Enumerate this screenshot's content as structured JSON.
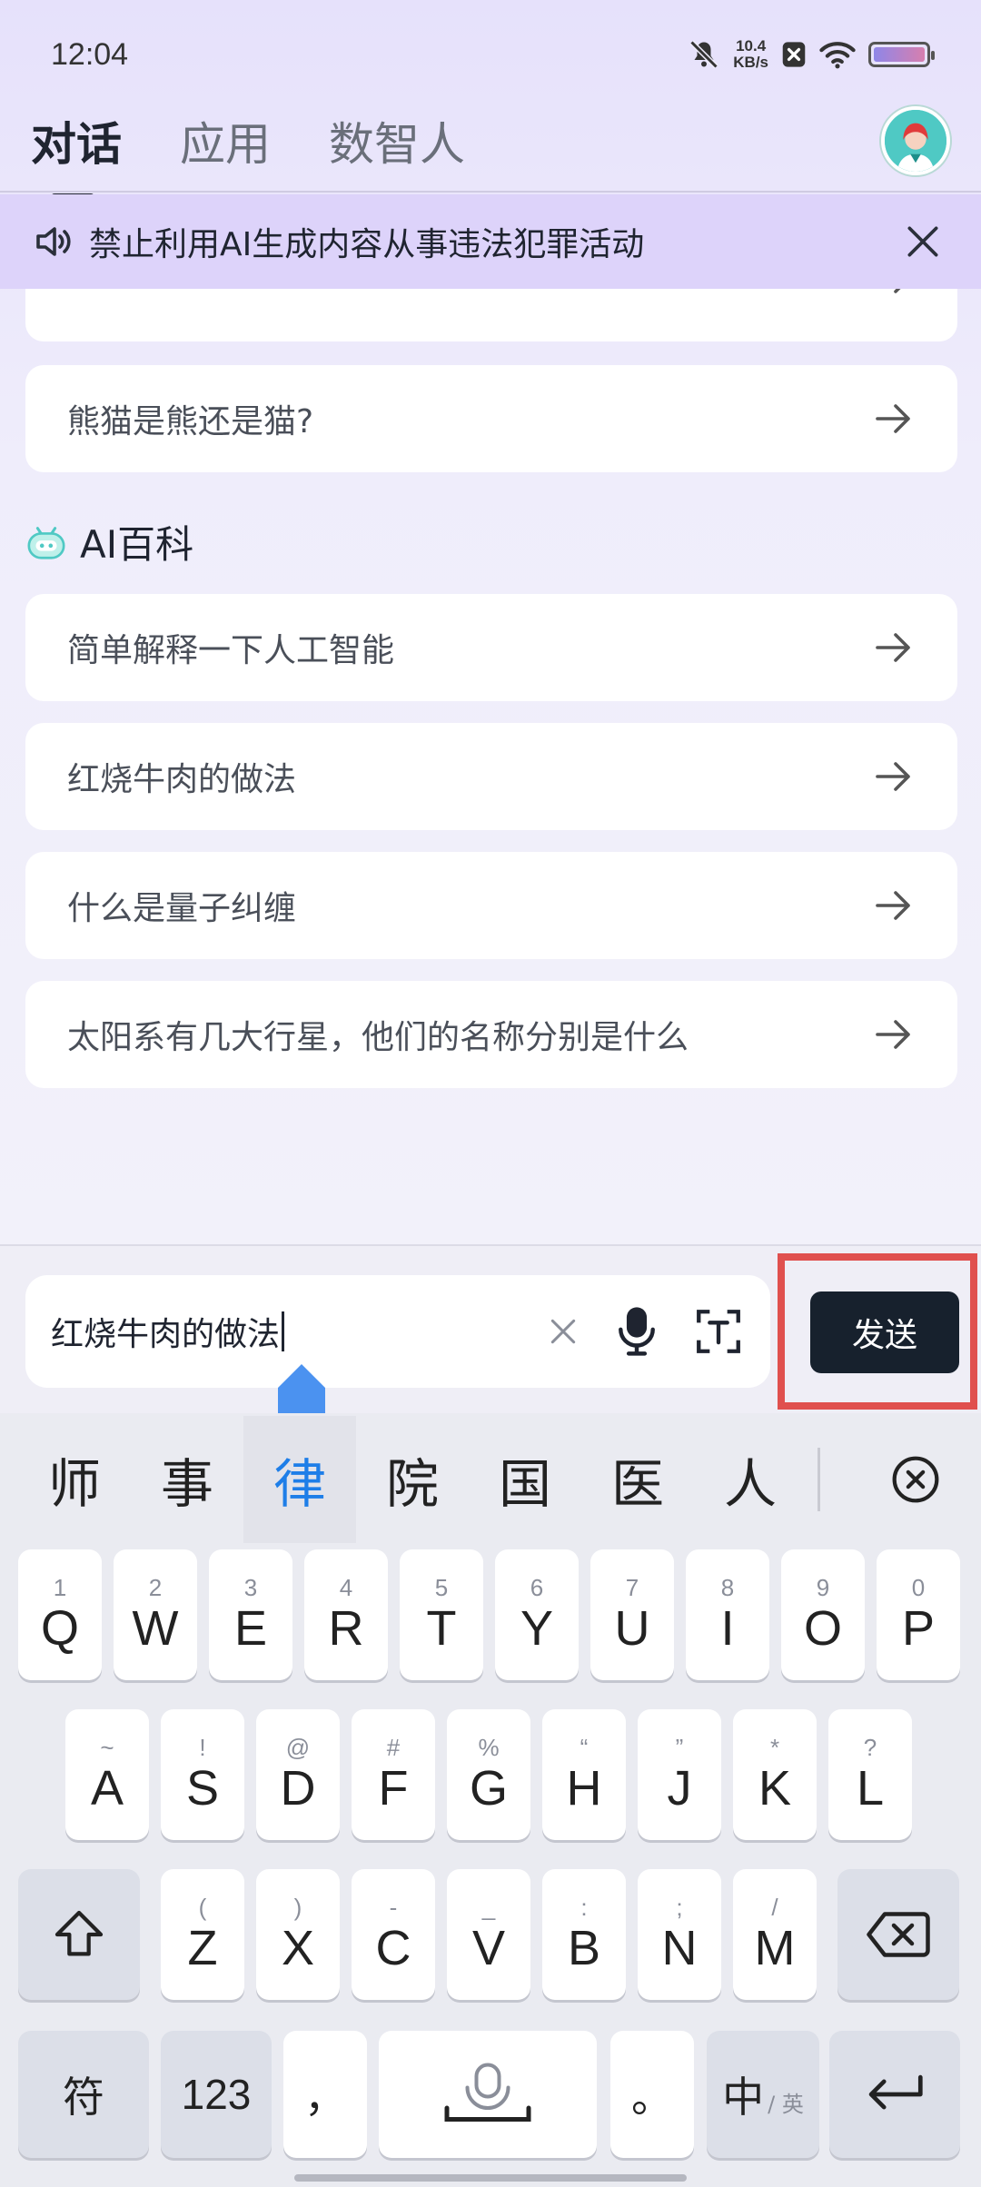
{
  "status_bar": {
    "time": "12:04",
    "net_speed_value": "10.4",
    "net_speed_unit": "KB/s",
    "icons": [
      "mute-bell-icon",
      "no-sim-icon",
      "wifi-icon",
      "battery-icon"
    ]
  },
  "header": {
    "tabs": [
      {
        "label": "对话",
        "active": true
      },
      {
        "label": "应用",
        "active": false
      },
      {
        "label": "数智人",
        "active": false
      }
    ]
  },
  "notice": {
    "text": "禁止利用AI生成内容从事违法犯罪活动"
  },
  "suggestions_top": [
    {
      "label": "熊猫是熊还是猫?"
    }
  ],
  "section": {
    "title": "AI百科",
    "items": [
      {
        "label": "简单解释一下人工智能"
      },
      {
        "label": "红烧牛肉的做法"
      },
      {
        "label": "什么是量子纠缠"
      },
      {
        "label": "太阳系有几大行星，他们的名称分别是什么"
      }
    ]
  },
  "input": {
    "value": "红烧牛肉的做法",
    "send_label": "发送"
  },
  "keyboard": {
    "candidates": [
      "师",
      "事",
      "律",
      "院",
      "国",
      "医",
      "人"
    ],
    "selected_candidate": "律",
    "row1": [
      {
        "main": "Q",
        "sub": "1"
      },
      {
        "main": "W",
        "sub": "2"
      },
      {
        "main": "E",
        "sub": "3"
      },
      {
        "main": "R",
        "sub": "4"
      },
      {
        "main": "T",
        "sub": "5"
      },
      {
        "main": "Y",
        "sub": "6"
      },
      {
        "main": "U",
        "sub": "7"
      },
      {
        "main": "I",
        "sub": "8"
      },
      {
        "main": "O",
        "sub": "9"
      },
      {
        "main": "P",
        "sub": "0"
      }
    ],
    "row2": [
      {
        "main": "A",
        "sub": "~"
      },
      {
        "main": "S",
        "sub": "!"
      },
      {
        "main": "D",
        "sub": "@"
      },
      {
        "main": "F",
        "sub": "#"
      },
      {
        "main": "G",
        "sub": "%"
      },
      {
        "main": "H",
        "sub": "“"
      },
      {
        "main": "J",
        "sub": "”"
      },
      {
        "main": "K",
        "sub": "*"
      },
      {
        "main": "L",
        "sub": "?"
      }
    ],
    "row3": [
      {
        "main": "Z",
        "sub": "("
      },
      {
        "main": "X",
        "sub": ")"
      },
      {
        "main": "C",
        "sub": "-"
      },
      {
        "main": "V",
        "sub": "_"
      },
      {
        "main": "B",
        "sub": ":"
      },
      {
        "main": "N",
        "sub": ";"
      },
      {
        "main": "M",
        "sub": "/"
      }
    ],
    "symbol_key": "符",
    "number_key": "123",
    "comma_key": "，",
    "period_key": "。",
    "lang_key_main": "中",
    "lang_key_sub": "/ 英"
  }
}
